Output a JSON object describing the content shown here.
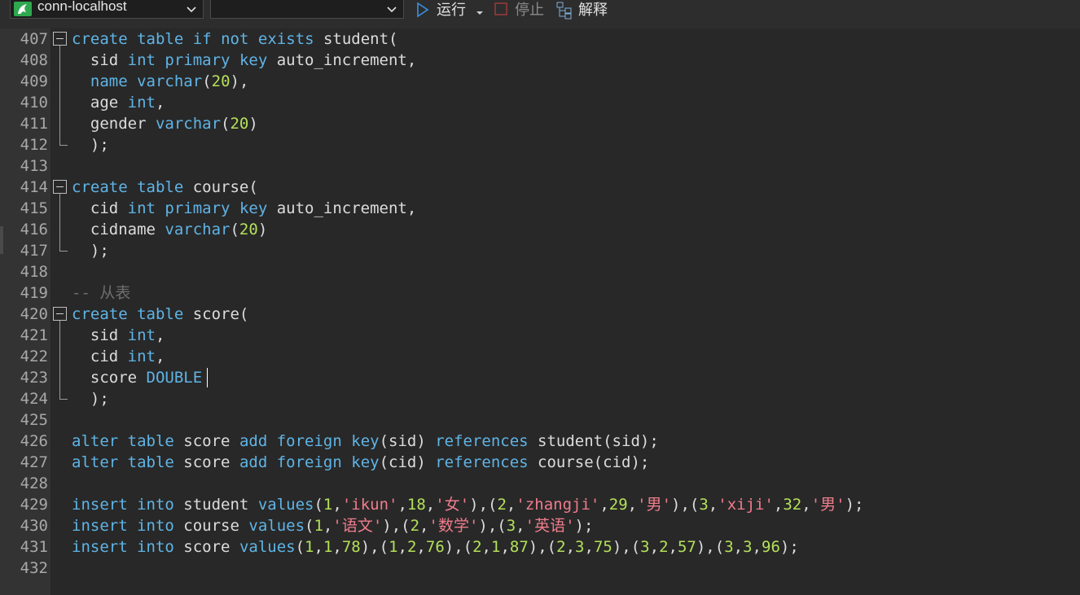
{
  "toolbar": {
    "connection": "conn-localhost",
    "database": "",
    "run_label": "运行",
    "stop_label": "停止",
    "explain_label": "解释",
    "icons": [
      "database-icon",
      "chevron-down-icon",
      "play-icon",
      "stop-icon",
      "explain-icon"
    ]
  },
  "editor": {
    "lines": [
      {
        "no": "407",
        "tokens": [
          [
            "kw",
            "create"
          ],
          [
            "p",
            " "
          ],
          [
            "kw",
            "table"
          ],
          [
            "p",
            " "
          ],
          [
            "kw",
            "if"
          ],
          [
            "p",
            " "
          ],
          [
            "kw",
            "not"
          ],
          [
            "p",
            " "
          ],
          [
            "kw",
            "exists"
          ],
          [
            "p",
            " student("
          ]
        ]
      },
      {
        "no": "408",
        "tokens": [
          [
            "p",
            "  sid "
          ],
          [
            "kw",
            "int"
          ],
          [
            "p",
            " "
          ],
          [
            "kw",
            "primary"
          ],
          [
            "p",
            " "
          ],
          [
            "kw",
            "key"
          ],
          [
            "p",
            " auto_increment,"
          ]
        ]
      },
      {
        "no": "409",
        "tokens": [
          [
            "p",
            "  "
          ],
          [
            "kw",
            "name"
          ],
          [
            "p",
            " "
          ],
          [
            "kw",
            "varchar"
          ],
          [
            "p",
            "("
          ],
          [
            "num",
            "20"
          ],
          [
            "p",
            "),"
          ]
        ]
      },
      {
        "no": "410",
        "tokens": [
          [
            "p",
            "  age "
          ],
          [
            "kw",
            "int"
          ],
          [
            "p",
            ","
          ]
        ]
      },
      {
        "no": "411",
        "tokens": [
          [
            "p",
            "  gender "
          ],
          [
            "kw",
            "varchar"
          ],
          [
            "p",
            "("
          ],
          [
            "num",
            "20"
          ],
          [
            "p",
            ")"
          ]
        ]
      },
      {
        "no": "412",
        "tokens": [
          [
            "p",
            "  );"
          ]
        ]
      },
      {
        "no": "413",
        "tokens": []
      },
      {
        "no": "414",
        "tokens": [
          [
            "kw",
            "create"
          ],
          [
            "p",
            " "
          ],
          [
            "kw",
            "table"
          ],
          [
            "p",
            " course("
          ]
        ]
      },
      {
        "no": "415",
        "tokens": [
          [
            "p",
            "  cid "
          ],
          [
            "kw",
            "int"
          ],
          [
            "p",
            " "
          ],
          [
            "kw",
            "primary"
          ],
          [
            "p",
            " "
          ],
          [
            "kw",
            "key"
          ],
          [
            "p",
            " auto_increment,"
          ]
        ]
      },
      {
        "no": "416",
        "tokens": [
          [
            "p",
            "  cidname "
          ],
          [
            "kw",
            "varchar"
          ],
          [
            "p",
            "("
          ],
          [
            "num",
            "20"
          ],
          [
            "p",
            ")"
          ]
        ]
      },
      {
        "no": "417",
        "tokens": [
          [
            "p",
            "  );"
          ]
        ]
      },
      {
        "no": "418",
        "tokens": []
      },
      {
        "no": "419",
        "tokens": [
          [
            "cmt",
            "-- 从表"
          ]
        ]
      },
      {
        "no": "420",
        "tokens": [
          [
            "kw",
            "create"
          ],
          [
            "p",
            " "
          ],
          [
            "kw",
            "table"
          ],
          [
            "p",
            " score("
          ]
        ]
      },
      {
        "no": "421",
        "tokens": [
          [
            "p",
            "  sid "
          ],
          [
            "kw",
            "int"
          ],
          [
            "p",
            ","
          ]
        ]
      },
      {
        "no": "422",
        "tokens": [
          [
            "p",
            "  cid "
          ],
          [
            "kw",
            "int"
          ],
          [
            "p",
            ","
          ]
        ]
      },
      {
        "no": "423",
        "tokens": [
          [
            "p",
            "  score "
          ],
          [
            "kw",
            "DOUBLE"
          ]
        ]
      },
      {
        "no": "424",
        "tokens": [
          [
            "p",
            "  );"
          ]
        ]
      },
      {
        "no": "425",
        "tokens": []
      },
      {
        "no": "426",
        "tokens": [
          [
            "kw",
            "alter"
          ],
          [
            "p",
            " "
          ],
          [
            "kw",
            "table"
          ],
          [
            "p",
            " score "
          ],
          [
            "kw",
            "add"
          ],
          [
            "p",
            " "
          ],
          [
            "kw",
            "foreign"
          ],
          [
            "p",
            " "
          ],
          [
            "kw",
            "key"
          ],
          [
            "p",
            "(sid) "
          ],
          [
            "kw",
            "references"
          ],
          [
            "p",
            " student(sid);"
          ]
        ]
      },
      {
        "no": "427",
        "tokens": [
          [
            "kw",
            "alter"
          ],
          [
            "p",
            " "
          ],
          [
            "kw",
            "table"
          ],
          [
            "p",
            " score "
          ],
          [
            "kw",
            "add"
          ],
          [
            "p",
            " "
          ],
          [
            "kw",
            "foreign"
          ],
          [
            "p",
            " "
          ],
          [
            "kw",
            "key"
          ],
          [
            "p",
            "(cid) "
          ],
          [
            "kw",
            "references"
          ],
          [
            "p",
            " course(cid);"
          ]
        ]
      },
      {
        "no": "428",
        "tokens": []
      },
      {
        "no": "429",
        "tokens": [
          [
            "kw",
            "insert"
          ],
          [
            "p",
            " "
          ],
          [
            "kw",
            "into"
          ],
          [
            "p",
            " student "
          ],
          [
            "kw",
            "values"
          ],
          [
            "p",
            "("
          ],
          [
            "num",
            "1"
          ],
          [
            "p",
            ","
          ],
          [
            "str",
            "'ikun'"
          ],
          [
            "p",
            ","
          ],
          [
            "num",
            "18"
          ],
          [
            "p",
            ","
          ],
          [
            "str",
            "'女'"
          ],
          [
            "p",
            "),("
          ],
          [
            "num",
            "2"
          ],
          [
            "p",
            ","
          ],
          [
            "str",
            "'zhangji'"
          ],
          [
            "p",
            ","
          ],
          [
            "num",
            "29"
          ],
          [
            "p",
            ","
          ],
          [
            "str",
            "'男'"
          ],
          [
            "p",
            "),("
          ],
          [
            "num",
            "3"
          ],
          [
            "p",
            ","
          ],
          [
            "str",
            "'xiji'"
          ],
          [
            "p",
            ","
          ],
          [
            "num",
            "32"
          ],
          [
            "p",
            ","
          ],
          [
            "str",
            "'男'"
          ],
          [
            "p",
            ");"
          ]
        ]
      },
      {
        "no": "430",
        "tokens": [
          [
            "kw",
            "insert"
          ],
          [
            "p",
            " "
          ],
          [
            "kw",
            "into"
          ],
          [
            "p",
            " course "
          ],
          [
            "kw",
            "values"
          ],
          [
            "p",
            "("
          ],
          [
            "num",
            "1"
          ],
          [
            "p",
            ","
          ],
          [
            "str",
            "'语文'"
          ],
          [
            "p",
            "),("
          ],
          [
            "num",
            "2"
          ],
          [
            "p",
            ","
          ],
          [
            "str",
            "'数学'"
          ],
          [
            "p",
            "),("
          ],
          [
            "num",
            "3"
          ],
          [
            "p",
            ","
          ],
          [
            "str",
            "'英语'"
          ],
          [
            "p",
            ");"
          ]
        ]
      },
      {
        "no": "431",
        "tokens": [
          [
            "kw",
            "insert"
          ],
          [
            "p",
            " "
          ],
          [
            "kw",
            "into"
          ],
          [
            "p",
            " score "
          ],
          [
            "kw",
            "values"
          ],
          [
            "p",
            "("
          ],
          [
            "num",
            "1"
          ],
          [
            "p",
            ","
          ],
          [
            "num",
            "1"
          ],
          [
            "p",
            ","
          ],
          [
            "num",
            "78"
          ],
          [
            "p",
            "),("
          ],
          [
            "num",
            "1"
          ],
          [
            "p",
            ","
          ],
          [
            "num",
            "2"
          ],
          [
            "p",
            ","
          ],
          [
            "num",
            "76"
          ],
          [
            "p",
            "),("
          ],
          [
            "num",
            "2"
          ],
          [
            "p",
            ","
          ],
          [
            "num",
            "1"
          ],
          [
            "p",
            ","
          ],
          [
            "num",
            "87"
          ],
          [
            "p",
            "),("
          ],
          [
            "num",
            "2"
          ],
          [
            "p",
            ","
          ],
          [
            "num",
            "3"
          ],
          [
            "p",
            ","
          ],
          [
            "num",
            "75"
          ],
          [
            "p",
            "),("
          ],
          [
            "num",
            "3"
          ],
          [
            "p",
            ","
          ],
          [
            "num",
            "2"
          ],
          [
            "p",
            ","
          ],
          [
            "num",
            "57"
          ],
          [
            "p",
            "),("
          ],
          [
            "num",
            "3"
          ],
          [
            "p",
            ","
          ],
          [
            "num",
            "3"
          ],
          [
            "p",
            ","
          ],
          [
            "num",
            "96"
          ],
          [
            "p",
            ");"
          ]
        ]
      },
      {
        "no": "432",
        "tokens": []
      }
    ]
  },
  "colors": {
    "background": "#282828",
    "keyword": "#5fb4e6",
    "number": "#b4e05a",
    "string": "#f07c8c",
    "comment": "#6e6e6e",
    "plain": "#dcdcdc"
  }
}
